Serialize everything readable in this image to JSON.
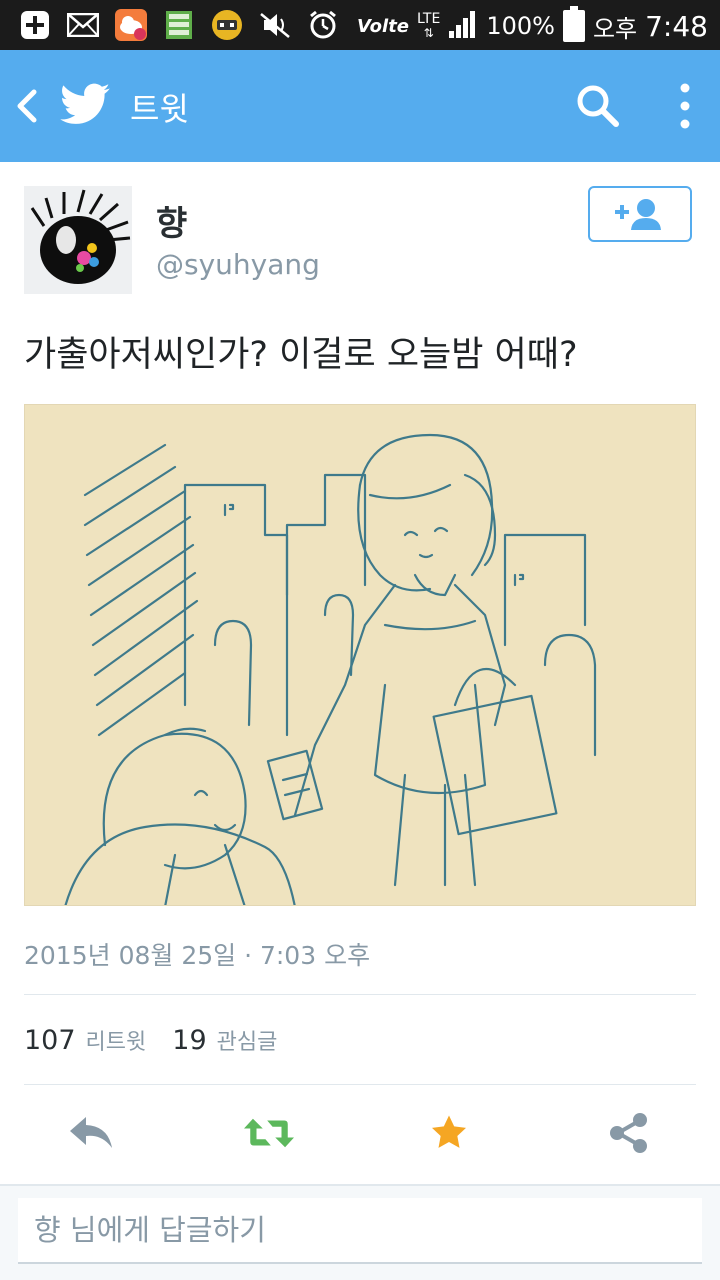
{
  "status_bar": {
    "battery": "100%",
    "ampm": "오후",
    "time": "7:48",
    "volte": "Volte",
    "network": "LTE",
    "icons": [
      "add-icon",
      "mail-icon",
      "cloud-app-icon",
      "sheet-app-icon",
      "game-app-icon",
      "mute-icon",
      "alarm-icon",
      "volte-icon",
      "lte-icon",
      "signal-icon",
      "battery-icon"
    ]
  },
  "app_bar": {
    "title": "트윗",
    "icons": [
      "back-icon",
      "twitter-bird-icon",
      "search-icon",
      "more-vert-icon"
    ],
    "color": "#55acee"
  },
  "tweet": {
    "author_name": "향",
    "author_handle": "@syuhyang",
    "text": "가출아저씨인가? 이걸로 오늘밤 어때?",
    "timestamp": "2015년 08월 25일 · 7:03 오후",
    "retweet_count": "107",
    "retweet_label": "리트윗",
    "like_count": "19",
    "like_label": "관심글",
    "media_description": "blue ink sketch on beige paper"
  },
  "actions": {
    "icons": [
      "reply-icon",
      "retweet-icon",
      "favorite-icon",
      "share-icon"
    ],
    "colors": {
      "reply": "#8899a6",
      "retweet": "#5cb85c",
      "favorite": "#f5a623",
      "share": "#8899a6"
    }
  },
  "reply": {
    "placeholder": "향 님에게 답글하기"
  }
}
